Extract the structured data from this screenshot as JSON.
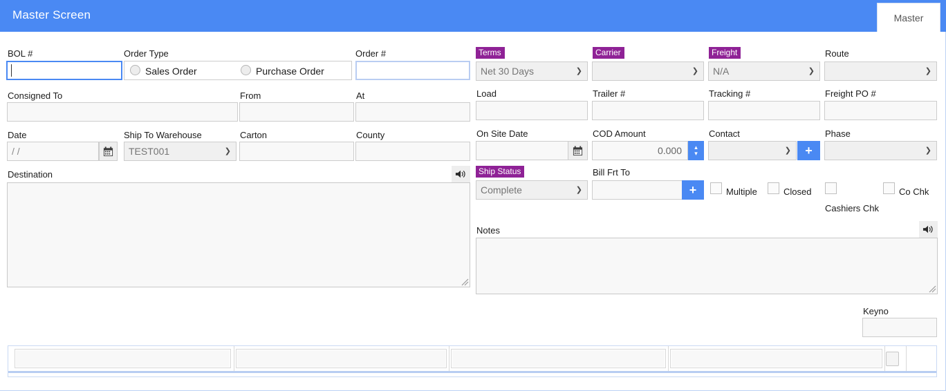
{
  "window": {
    "title": "Master Screen",
    "accent_blue": "#4a89f3",
    "tag_purple": "#8f2296"
  },
  "tabs": [
    {
      "label": "Master",
      "active": true
    }
  ],
  "left_panel": {
    "bol": {
      "label": "BOL #",
      "value": "",
      "focused": true
    },
    "order_type": {
      "label": "Order Type",
      "options": [
        {
          "label": "Sales Order",
          "checked": false
        },
        {
          "label": "Purchase Order",
          "checked": false
        }
      ]
    },
    "order_no": {
      "label": "Order #",
      "value": ""
    },
    "consigned_to": {
      "label": "Consigned To",
      "value": ""
    },
    "from": {
      "label": "From",
      "value": ""
    },
    "at": {
      "label": "At",
      "value": ""
    },
    "date": {
      "label": "Date",
      "value": "",
      "placeholder": "  /  /",
      "icon": "calendar-icon"
    },
    "ship_to_warehouse": {
      "label": "Ship To Warehouse",
      "value": "TEST001"
    },
    "carton": {
      "label": "Carton",
      "value": ""
    },
    "county": {
      "label": "County",
      "value": ""
    },
    "destination": {
      "label": "Destination",
      "value": "",
      "speaker_icon": "speaker-icon"
    }
  },
  "right_panel": {
    "terms": {
      "label": "Terms",
      "value": "Net 30 Days",
      "tag": true
    },
    "carrier": {
      "label": "Carrier",
      "value": "",
      "tag": true
    },
    "freight": {
      "label": "Freight",
      "value": "N/A",
      "tag": true
    },
    "route": {
      "label": "Route",
      "value": ""
    },
    "load": {
      "label": "Load",
      "value": ""
    },
    "trailer": {
      "label": "Trailer #",
      "value": ""
    },
    "tracking": {
      "label": "Tracking #",
      "value": ""
    },
    "freight_po": {
      "label": "Freight PO #",
      "value": ""
    },
    "on_site_date": {
      "label": "On Site Date",
      "value": "",
      "icon": "calendar-icon"
    },
    "cod_amount": {
      "label": "COD Amount",
      "value": "0.000"
    },
    "contact": {
      "label": "Contact",
      "value": "",
      "add_button": "+"
    },
    "phase": {
      "label": "Phase",
      "value": ""
    },
    "ship_status": {
      "label": "Ship Status",
      "value": "Complete",
      "tag": true
    },
    "bill_frt_to": {
      "label": "Bill Frt To",
      "value": "",
      "add_button": "+"
    },
    "checkboxes": [
      {
        "label": "Multiple",
        "checked": false,
        "label_position": "right"
      },
      {
        "label": "Closed",
        "checked": false,
        "label_position": "right"
      },
      {
        "label": "Cashiers Chk",
        "checked": false,
        "label_position": "below"
      },
      {
        "label": "Co Chk",
        "checked": false,
        "label_position": "right"
      }
    ],
    "notes": {
      "label": "Notes",
      "value": "",
      "speaker_icon": "speaker-icon"
    },
    "keyno": {
      "label": "Keyno",
      "value": ""
    }
  },
  "bottom_bar": {
    "cells": [
      "",
      "",
      "",
      ""
    ],
    "checkbox": {
      "checked": false
    }
  }
}
